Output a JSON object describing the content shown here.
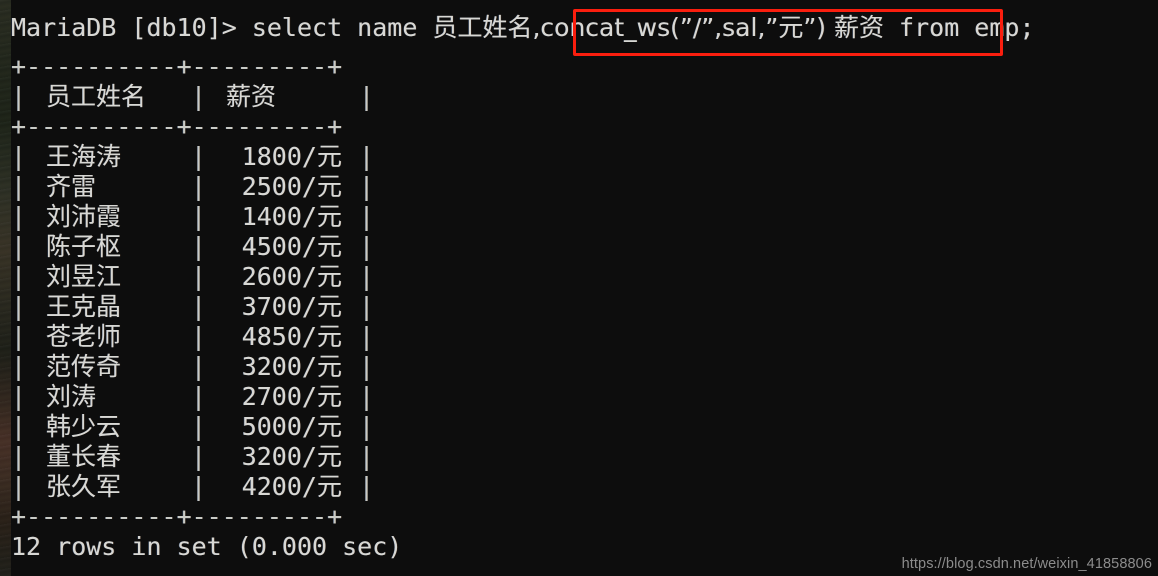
{
  "terminal": {
    "prompt": "MariaDB [db10]> ",
    "command_before": "select name ",
    "command_alias1": "员工姓名,",
    "highlighted_expression": "concat_ws(”/”,sal,”元”) 薪资",
    "command_after": " from emp;",
    "full_command": "MariaDB [db10]> select name 员工姓名,concat_ws(”/”,sal,”元”) 薪资 from emp;"
  },
  "table": {
    "top_rule": "+----------+---------+",
    "header_rule": "+----------+---------+",
    "bottom_rule": "+----------+---------+",
    "columns": [
      "员工姓名",
      "薪资"
    ],
    "rows": [
      {
        "name": "王海涛",
        "salary": "1800/元",
        "amount": "1800",
        "unit": "元"
      },
      {
        "name": "齐雷",
        "salary": "2500/元",
        "amount": "2500",
        "unit": "元"
      },
      {
        "name": "刘沛霞",
        "salary": "1400/元",
        "amount": "1400",
        "unit": "元"
      },
      {
        "name": "陈子枢",
        "salary": "4500/元",
        "amount": "4500",
        "unit": "元"
      },
      {
        "name": "刘昱江",
        "salary": "2600/元",
        "amount": "2600",
        "unit": "元"
      },
      {
        "name": "王克晶",
        "salary": "3700/元",
        "amount": "3700",
        "unit": "元"
      },
      {
        "name": "苍老师",
        "salary": "4850/元",
        "amount": "4850",
        "unit": "元"
      },
      {
        "name": "范传奇",
        "salary": "3200/元",
        "amount": "3200",
        "unit": "元"
      },
      {
        "name": "刘涛",
        "salary": "2700/元",
        "amount": "2700",
        "unit": "元"
      },
      {
        "name": "韩少云",
        "salary": "5000/元",
        "amount": "5000",
        "unit": "元"
      },
      {
        "name": "董长春",
        "salary": "3200/元",
        "amount": "3200",
        "unit": "元"
      },
      {
        "name": "张久军",
        "salary": "4200/元",
        "amount": "4200",
        "unit": "元"
      }
    ]
  },
  "status": {
    "text": "12 rows in set (0.000 sec)",
    "row_count": "12",
    "elapsed": "0.000"
  },
  "watermark": {
    "url": "https://blog.csdn.net/weixin_41858806"
  },
  "colors": {
    "background": "#0d0d0d",
    "foreground": "#d8d8d4",
    "highlight_border": "#fa1e0e",
    "watermark": "#8c8c8c"
  }
}
